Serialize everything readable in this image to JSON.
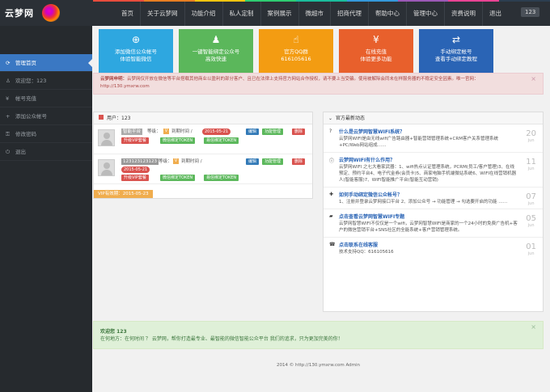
{
  "brand": {
    "logo_text": "云梦网"
  },
  "topnav": {
    "items": [
      "首页",
      "关于云梦网",
      "功能介绍",
      "私人定制",
      "案例展示",
      "微超市",
      "招商代理",
      "帮助中心",
      "管理中心",
      "资费说明",
      "退出"
    ],
    "message_count": "123"
  },
  "rainbow_colors": [
    "#e74c3c",
    "#e67e22",
    "#f1c40f",
    "#2ecc71",
    "#1abc9c",
    "#3498db",
    "#9b59b6",
    "#e84393",
    "#2c3e50"
  ],
  "sidebar": {
    "items": [
      {
        "label": "管理首页",
        "icon": "refresh-icon"
      },
      {
        "label": "欢迎您：123",
        "icon": "user-icon"
      },
      {
        "label": "帐号充值",
        "icon": "money-icon"
      },
      {
        "label": "添加公众帐号",
        "icon": "plus-icon"
      },
      {
        "label": "修改密码",
        "icon": "key-icon"
      },
      {
        "label": "退出",
        "icon": "logout-icon"
      }
    ]
  },
  "tiles": [
    {
      "line1": "添加微信公众帐号",
      "line2": "体验智能微信",
      "icon": "plus-circle-icon"
    },
    {
      "line1": "一键智能绑定公众号",
      "line2": "高效快速",
      "icon": "user-icon"
    },
    {
      "line1": "官方QQ群",
      "line2": "616105616",
      "icon": "thumbs-up-icon"
    },
    {
      "line1": "在线充值",
      "line2": "体验更多功能",
      "icon": "money-icon"
    },
    {
      "line1": "手动绑定帐号",
      "line2": "查看手动绑定教程",
      "icon": "shuffle-icon"
    }
  ],
  "warning": {
    "title": "云梦网申明：",
    "text": "云梦网仅开放在微信等平台搭载其他商业以盈利的部分客户、且已在法律上支持官方网站合作授权，请不要上当受骗。使用被解除会同未在样服务器的不稳定安全因素。唯一官网：",
    "url": "http://130.ymxrw.com"
  },
  "user_panel": {
    "title": "用户：123",
    "users": [
      {
        "name": "智能平台",
        "level_label": "等级：",
        "expire_label": "到期时间 /",
        "expire_date": "2015-05-21",
        "btn_edit": "编辑",
        "btn_func": "功能管理",
        "btn_delete": "删除",
        "btn_upgrade": "升级VIP套餐",
        "btn_bind": "微信绑定TOKEN",
        "btn_bind2": "易信绑定TOKEN"
      },
      {
        "name": "123123123123",
        "level_label": "等级：",
        "expire_label": "到期时间 /",
        "expire_date": "2015-05-21",
        "btn_edit": "编辑",
        "btn_func": "功能管理",
        "btn_delete": "删除",
        "btn_upgrade": "升级VIP套餐",
        "btn_bind": "微信绑定TOKEN",
        "btn_bind2": "易信绑定TOKEN"
      }
    ],
    "vip_date": "VIP有效期：2015-05-23"
  },
  "news": {
    "title": "官方最新动态",
    "items": [
      {
        "icon": "question-icon",
        "title": "什么是云梦网智慧WIFI系统？",
        "body": "云梦网WIFI是由无线wifi广告路由器+智能营销管理系统+CRM客户关系管理系统+PC/Web网站组成……",
        "day": "20",
        "month": "jun"
      },
      {
        "icon": "info-icon",
        "title": "云梦网WIFI有什么作用？",
        "body": "云梦网WIFI 之七大看家武器：1、wifi热点认证管理系统，PCRM(员工/客户管理)3、在线预定、预约平台4、电子代金券(会员卡)5、商家电脑手机端微站系统6、WIFI在线营销机器人(智能客服)7、WIFI智能推广平台(智能互动营销)",
        "day": "11",
        "month": "jun"
      },
      {
        "icon": "plus-icon",
        "title": "如何手动绑定微信公众帐号？",
        "body": "1、注册并登录云梦网接口平台 2、添加公众号 → 功能管理 → 勾选要开启的功能 ……",
        "day": "07",
        "month": "jun"
      },
      {
        "icon": "book-icon",
        "title": "点击查看云梦网智慧WIFI专题",
        "body": "云梦网智慧WIFI不仅仅是一个wifi，云梦网智慧WIFI是商家的一个24小时的免费广告机+客户的微信营销平台+SNS社区的全能系统+客户营销管理系统。",
        "day": "05",
        "month": "jun"
      },
      {
        "icon": "phone-icon",
        "title": "点击联系在线客服",
        "body": "技术支持QQ：616105616",
        "day": "01",
        "month": "jun"
      }
    ]
  },
  "welcome": {
    "line1": "欢迎您 123",
    "line2": "在何地方：在何时间 ？ 云梦网，帮你打造最专业、最智能的微信智能公众平台 我们的追求，只为更加完美的你！"
  },
  "footer": {
    "text": "2014 © http://130.ymxrw.com Admin"
  }
}
